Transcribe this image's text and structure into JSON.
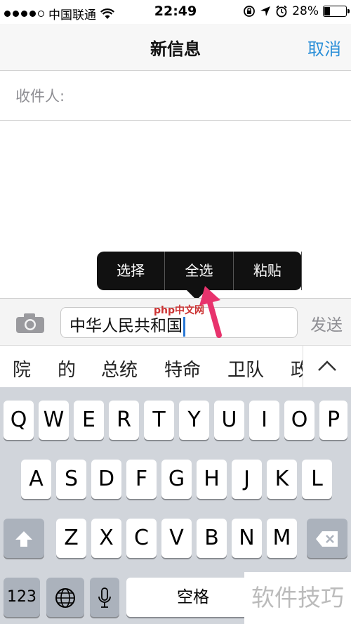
{
  "status_bar": {
    "carrier": "中国联通",
    "time": "22:49",
    "battery": "28%",
    "battery_level": 0.28
  },
  "nav": {
    "title": "新信息",
    "cancel": "取消"
  },
  "recipient": {
    "label": "收件人:"
  },
  "compose": {
    "text": "中华人民共和国",
    "send": "发送"
  },
  "popup": {
    "items": [
      "选择",
      "全选",
      "粘贴"
    ]
  },
  "candidates": [
    "院",
    "的",
    "总统",
    "特命",
    "卫队",
    "政"
  ],
  "keyboard": {
    "row1": [
      "Q",
      "W",
      "E",
      "R",
      "T",
      "Y",
      "U",
      "I",
      "O",
      "P"
    ],
    "row2": [
      "A",
      "S",
      "D",
      "F",
      "G",
      "H",
      "J",
      "K",
      "L"
    ],
    "row3": [
      "Z",
      "X",
      "C",
      "V",
      "B",
      "N",
      "M"
    ],
    "num_key": "123",
    "space": "空格"
  },
  "watermark": {
    "text": "软件技巧",
    "logo_text": "php中文网"
  }
}
